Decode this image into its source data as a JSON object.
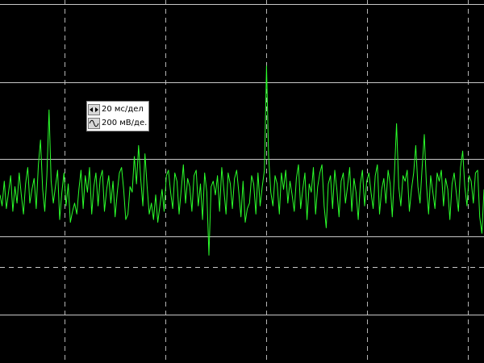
{
  "colors": {
    "background": "#000000",
    "grid_solid": "#c8c8c8",
    "grid_dashed": "#b4b4b4",
    "trace": "#2bff2b"
  },
  "scale_panel": {
    "time_per_div": "20 мс/дел",
    "time_icon": "horizontal-arrows-icon",
    "volts_per_div": "200 мВ/де.",
    "volts_icon": "sine-wave-icon"
  },
  "chart_data": {
    "type": "line",
    "grid": true,
    "series": [
      {
        "values": [
          0.1,
          -0.3,
          0.6,
          -0.4,
          0.2,
          0.8,
          -0.5,
          0.4,
          -0.2,
          0.9,
          0.1,
          -0.6,
          0.5,
          1.1,
          -0.2,
          0.3,
          0.7,
          -0.4,
          1.2,
          2.1,
          0.3,
          -0.5,
          0.8,
          3.2,
          0.6,
          -0.2,
          0.4,
          1.0,
          -0.8,
          0.2,
          0.9,
          -0.3,
          0.5,
          -0.9,
          -0.5,
          -0.2,
          -0.6,
          0.3,
          1.0,
          -0.4,
          0.8,
          0.2,
          1.1,
          -0.6,
          0.4,
          0.9,
          -0.3,
          0.7,
          1.0,
          -0.5,
          0.3,
          0.8,
          -0.2,
          0.6,
          -0.7,
          0.2,
          0.9,
          1.1,
          0.3,
          -0.8,
          -0.6,
          0.4,
          0.2,
          1.5,
          0.5,
          1.9,
          0.7,
          -0.3,
          1.6,
          0.4,
          -0.6,
          -0.2,
          -0.8,
          0.1,
          -0.9,
          -0.3,
          0.3,
          -0.5,
          0.8,
          1.0,
          0.2,
          -0.4,
          0.9,
          0.6,
          -0.6,
          0.3,
          1.2,
          -0.2,
          0.7,
          0.4,
          -0.5,
          0.8,
          1.0,
          -0.3,
          0.5,
          -0.8,
          0.9,
          0.2,
          -2.1,
          0.4,
          0.6,
          0.1,
          0.8,
          -0.5,
          1.1,
          0.3,
          -0.6,
          0.9,
          0.5,
          -0.4,
          0.7,
          1.0,
          0.2,
          -0.7,
          0.6,
          -0.9,
          -0.4,
          -0.2,
          0.8,
          0.5,
          -0.6,
          0.9,
          -0.3,
          0.4,
          1.0,
          4.8,
          1.5,
          0.2,
          -0.3,
          0.8,
          0.5,
          -0.6,
          0.9,
          0.3,
          1.0,
          -0.2,
          0.6,
          0.1,
          -0.5,
          0.7,
          1.2,
          -0.4,
          0.3,
          0.9,
          -0.8,
          0.5,
          0.2,
          1.1,
          -0.6,
          0.4,
          0.9,
          1.2,
          -0.3,
          -1.1,
          0.5,
          0.8,
          -0.4,
          1.0,
          0.3,
          -0.7,
          0.6,
          0.9,
          -0.2,
          0.4,
          1.1,
          -0.5,
          0.7,
          0.2,
          -0.8,
          0.5,
          1.0,
          -0.3,
          0.6,
          0.9,
          0.2,
          -0.4,
          0.8,
          1.2,
          -0.6,
          0.3,
          0.7,
          -0.2,
          1.0,
          0.5,
          -0.7,
          0.9,
          2.7,
          0.4,
          -0.3,
          0.8,
          0.6,
          1.0,
          -0.5,
          0.3,
          0.9,
          1.9,
          0.4,
          -0.2,
          1.1,
          2.3,
          0.5,
          -0.6,
          0.8,
          0.2,
          -0.4,
          0.9,
          0.6,
          1.0,
          -0.3,
          0.7,
          0.3,
          -0.8,
          0.5,
          0.9,
          0.2,
          -0.5,
          1.1,
          1.7,
          0.4,
          -0.3,
          0.8,
          0.6,
          -0.2,
          0.9,
          1.0,
          -0.7,
          -1.3,
          0.3
        ]
      }
    ]
  }
}
